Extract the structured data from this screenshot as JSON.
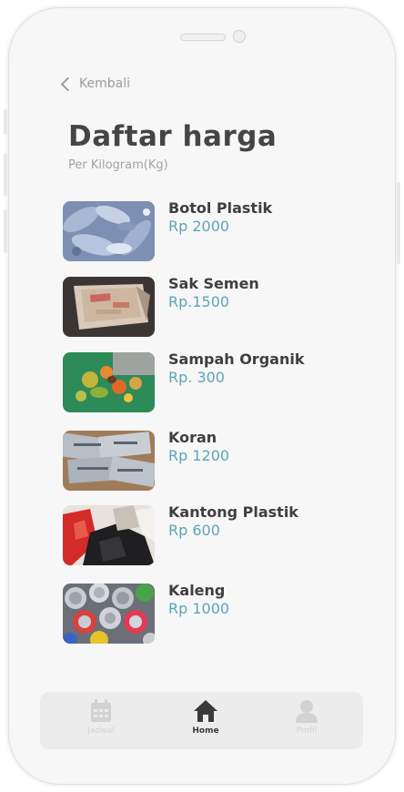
{
  "header": {
    "back_label": "Kembali",
    "title": "Daftar harga",
    "subtitle": "Per Kilogram(Kg)"
  },
  "items": [
    {
      "name": "Botol Plastik",
      "price": "Rp 2000",
      "image": "plastic-bottles-photo"
    },
    {
      "name": "Sak Semen",
      "price": "Rp.1500",
      "image": "cement-sack-photo"
    },
    {
      "name": "Sampah Organik",
      "price": "Rp. 300",
      "image": "organic-waste-photo"
    },
    {
      "name": "Koran",
      "price": "Rp 1200",
      "image": "newspaper-photo"
    },
    {
      "name": "Kantong Plastik",
      "price": "Rp 600",
      "image": "plastic-bags-photo"
    },
    {
      "name": "Kaleng",
      "price": "Rp 1000",
      "image": "cans-photo"
    }
  ],
  "tabbar": {
    "tabs": [
      {
        "label": "Jadwal",
        "icon": "calendar-icon",
        "active": false
      },
      {
        "label": "Home",
        "icon": "home-icon",
        "active": true
      },
      {
        "label": "Profil",
        "icon": "user-icon",
        "active": false
      }
    ]
  },
  "colors": {
    "price": "#5aa5b8",
    "title": "#454545",
    "tab_active": "#3a3a3a",
    "tab_inactive": "#d2d2d2"
  }
}
